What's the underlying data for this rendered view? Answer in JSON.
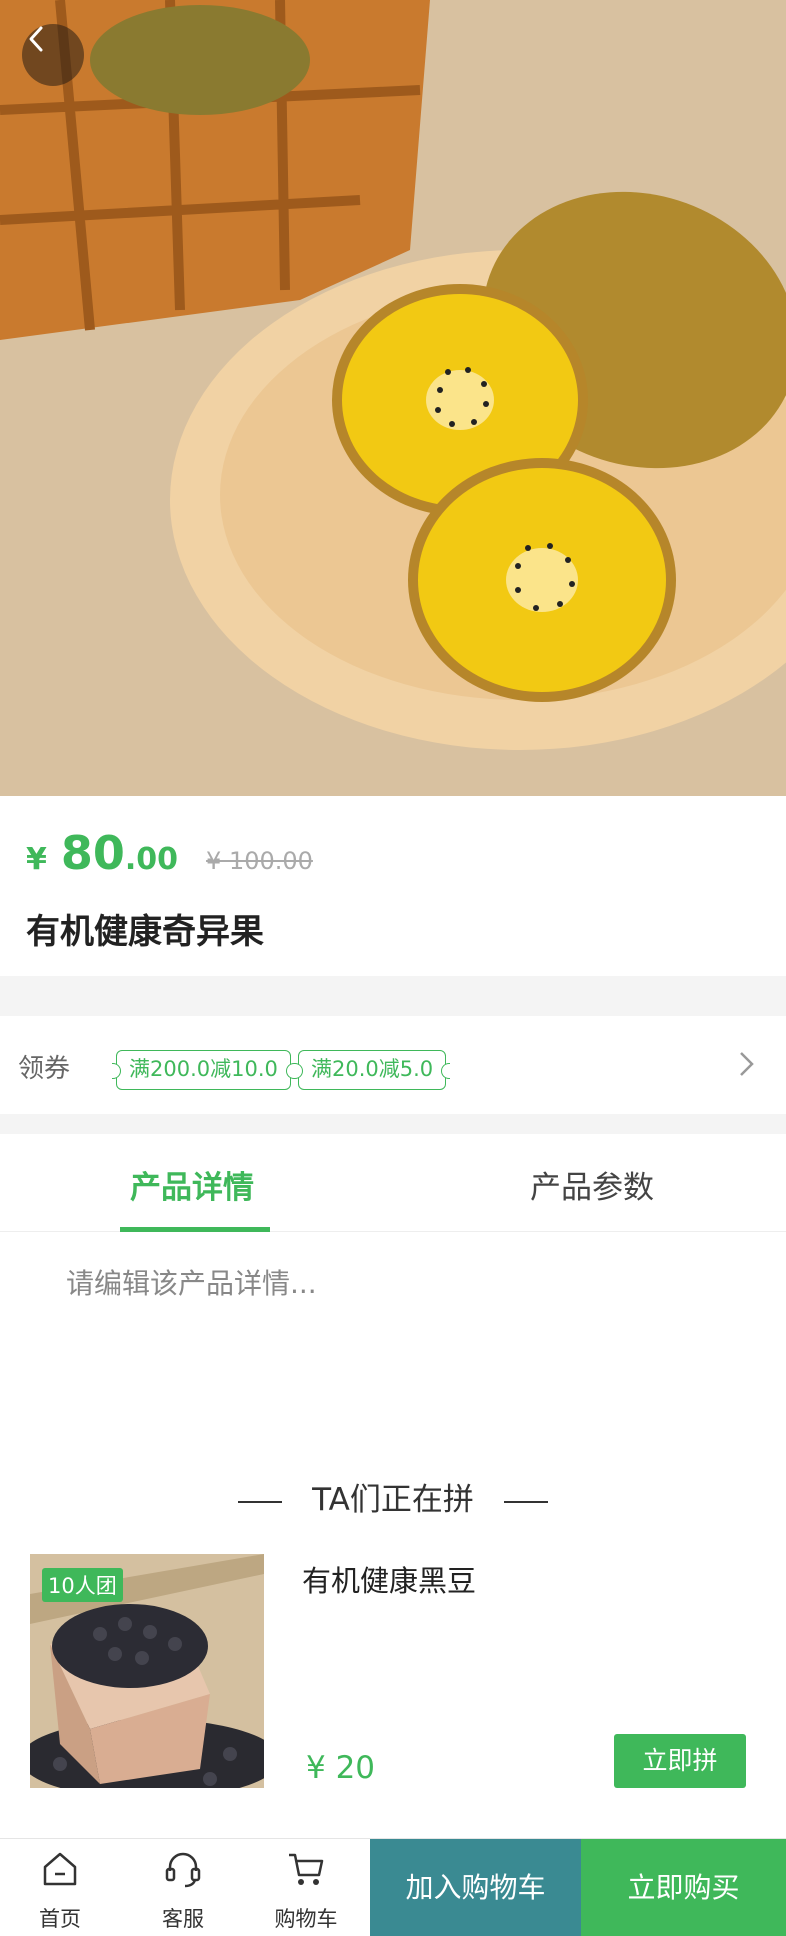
{
  "product": {
    "price_currency": "¥",
    "price_integer": "80",
    "price_decimal": ".00",
    "original_price": "¥ 100.00",
    "title": "有机健康奇异果"
  },
  "coupons": {
    "label": "领券",
    "items": [
      "满200.0减10.0",
      "满20.0减5.0"
    ]
  },
  "tabs": {
    "items": [
      "产品详情",
      "产品参数"
    ],
    "active": 0
  },
  "detail": {
    "placeholder_text": "请编辑该产品详情..."
  },
  "group_buy": {
    "section_title": "TA们正在拼",
    "item": {
      "badge": "10人团",
      "name": "有机健康黑豆",
      "price": "¥ 20",
      "join_label": "立即拼"
    }
  },
  "bottom_bar": {
    "home_label": "首页",
    "service_label": "客服",
    "cart_label": "购物车",
    "add_cart_label": "加入购物车",
    "buy_now_label": "立即购买"
  },
  "colors": {
    "accent": "#3fb85a",
    "add_cart_bg": "#3a8a92"
  }
}
